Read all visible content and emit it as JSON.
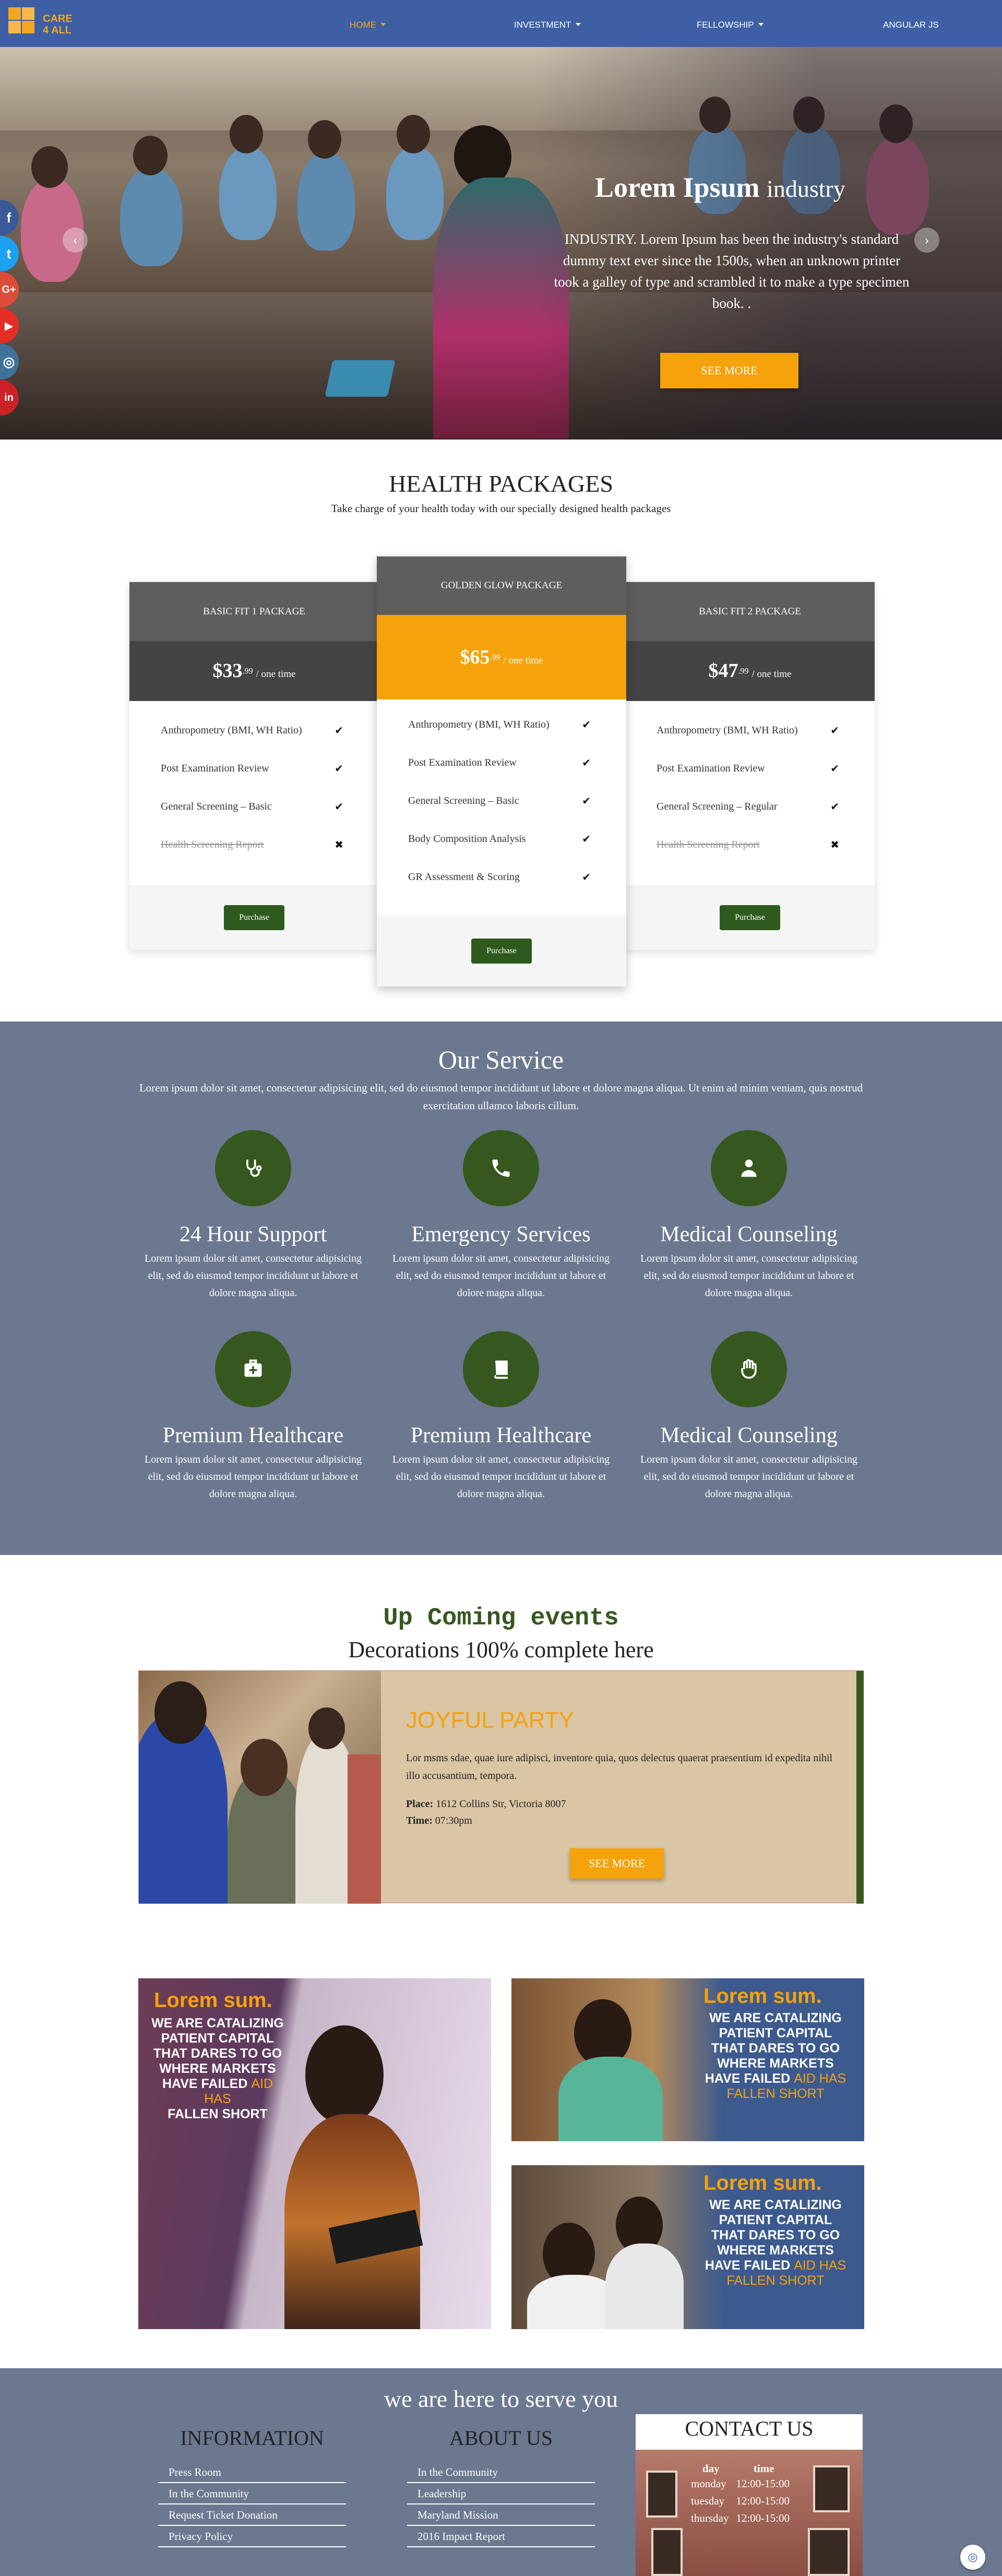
{
  "brand": {
    "line1": "CARE",
    "line2": "4 ALL"
  },
  "nav": {
    "items": [
      {
        "label": "HOME",
        "dropdown": true
      },
      {
        "label": "INVESTMENT",
        "dropdown": true
      },
      {
        "label": "FELLOWSHIP",
        "dropdown": true
      },
      {
        "label": "ANGULAR JS",
        "dropdown": false
      }
    ]
  },
  "hero": {
    "title": "Lorem Ipsum",
    "title_suffix": "industry",
    "text": "INDUSTRY. Lorem Ipsum has been the industry's standard dummy text ever since the 1500s, when an unknown printer took a galley of type and scrambled it to make a type specimen book. .",
    "button": "SEE MORE"
  },
  "social": [
    {
      "icon": "facebook-icon",
      "glyph": "f",
      "color": "#3b5998"
    },
    {
      "icon": "twitter-icon",
      "glyph": "t",
      "color": "#1da1f2"
    },
    {
      "icon": "google-plus-icon",
      "glyph": "G+",
      "color": "#dd4b39"
    },
    {
      "icon": "youtube-icon",
      "glyph": "▶",
      "color": "#e52d27"
    },
    {
      "icon": "instagram-icon",
      "glyph": "◎",
      "color": "#3f729b"
    },
    {
      "icon": "linkedin-icon",
      "glyph": "in",
      "color": "#cc2127"
    }
  ],
  "packages": {
    "title": "HEALTH PACKAGES",
    "subtitle": "Take charge of your health today with our specially designed health packages",
    "items": [
      {
        "name": "BASIC FIT 1 PACKAGE",
        "price": "$33",
        "cents": ".99",
        "period": "/ one time",
        "features": [
          {
            "text": "Anthropometry (BMI, WH Ratio)",
            "included": true
          },
          {
            "text": "Post Examination Review",
            "included": true
          },
          {
            "text": "General Screening – Basic",
            "included": true
          },
          {
            "text": "Health Screening Report",
            "included": false
          }
        ],
        "button": "Purchase"
      },
      {
        "name": "GOLDEN GLOW PACKAGE",
        "price": "$65",
        "cents": ".99",
        "period": "/ one time",
        "features": [
          {
            "text": "Anthropometry (BMI, WH Ratio)",
            "included": true
          },
          {
            "text": "Post Examination Review",
            "included": true
          },
          {
            "text": "General Screening – Basic",
            "included": true
          },
          {
            "text": "Body Composition Analysis",
            "included": true
          },
          {
            "text": "GR Assessment & Scoring",
            "included": true
          }
        ],
        "button": "Purchase"
      },
      {
        "name": "BASIC FIT 2 PACKAGE",
        "price": "$47",
        "cents": ".99",
        "period": "/ one time",
        "features": [
          {
            "text": "Anthropometry (BMI, WH Ratio)",
            "included": true
          },
          {
            "text": "Post Examination Review",
            "included": true
          },
          {
            "text": "General Screening – Regular",
            "included": true
          },
          {
            "text": "Health Screening Report",
            "included": false
          }
        ],
        "button": "Purchase"
      }
    ]
  },
  "service": {
    "title": "Our Service",
    "intro": "Lorem ipsum dolor sit amet, consectetur adipisicing elit, sed do eiusmod tempor incididunt ut labore et dolore magna aliqua. Ut enim ad minim veniam, quis nostrud exercitation ullamco laboris cillum.",
    "items": [
      {
        "icon": "stethoscope-icon",
        "title": "24 Hour Support",
        "text": "Lorem ipsum dolor sit amet, consectetur adipisicing elit, sed do eiusmod tempor incididunt ut labore et dolore magna aliqua."
      },
      {
        "icon": "phone-icon",
        "title": "Emergency Services",
        "text": "Lorem ipsum dolor sit amet, consectetur adipisicing elit, sed do eiusmod tempor incididunt ut labore et dolore magna aliqua."
      },
      {
        "icon": "doctor-icon",
        "title": "Medical Counseling",
        "text": "Lorem ipsum dolor sit amet, consectetur adipisicing elit, sed do eiusmod tempor incididunt ut labore et dolore magna aliqua."
      },
      {
        "icon": "medkit-icon",
        "title": "Premium Healthcare",
        "text": "Lorem ipsum dolor sit amet, consectetur adipisicing elit, sed do eiusmod tempor incididunt ut labore et dolore magna aliqua."
      },
      {
        "icon": "book-icon",
        "title": "Premium Healthcare",
        "text": "Lorem ipsum dolor sit amet, consectetur adipisicing elit, sed do eiusmod tempor incididunt ut labore et dolore magna aliqua."
      },
      {
        "icon": "hand-icon",
        "title": "Medical Counseling",
        "text": "Lorem ipsum dolor sit amet, consectetur adipisicing elit, sed do eiusmod tempor incididunt ut labore et dolore magna aliqua."
      }
    ]
  },
  "events": {
    "title": "Up Coming events",
    "subtitle": "Decorations 100% complete here",
    "card": {
      "heading": "JOYFUL PARTY",
      "text": "Lor msms sdae, quae iure adipisci, inventore quia, quos delectus quaerat praesentium id expedita nihil illo accusantium, tempora.",
      "place_label": "Place:",
      "place": "1612 Collins Str, Victoria 8007",
      "time_label": "Time:",
      "time": "07:30pm",
      "button": "SEE MORE"
    }
  },
  "promos": [
    {
      "heading": "Lorem sum.",
      "line1": "WE ARE CATALIZING",
      "line2": "PATIENT CAPITAL",
      "line3": "THAT DARES TO GO",
      "line4": "WHERE MARKETS",
      "line5": "HAVE FAILED",
      "accent": "AID HAS",
      "line6": "FALLEN SHORT"
    },
    {
      "heading": "Lorem sum.",
      "line1": "WE ARE CATALIZING",
      "line2": "PATIENT CAPITAL",
      "line3": "THAT DARES TO GO",
      "line4": "WHERE MARKETS",
      "line5": "HAVE FAILED",
      "accent": "AID HAS",
      "line6": "FALLEN SHORT"
    },
    {
      "heading": "Lorem sum.",
      "line1": "WE ARE CATALIZING",
      "line2": "PATIENT CAPITAL",
      "line3": "THAT DARES TO GO",
      "line4": "WHERE MARKETS",
      "line5": "HAVE FAILED",
      "accent": "AID HAS",
      "line6": "FALLEN SHORT"
    }
  ],
  "footer": {
    "title": "we are here to serve you",
    "information": {
      "title": "INFORMATION",
      "links": [
        "Press Room",
        "In the Community",
        "Request Ticket Donation",
        "Privacy Policy"
      ]
    },
    "about": {
      "title": "ABOUT US",
      "links": [
        "In the Community",
        "Leadership",
        "Maryland Mission",
        "2016 Impact Report"
      ]
    },
    "contact": {
      "title": "CONTACT US",
      "col_day": "day",
      "col_time": "time",
      "rows": [
        {
          "day": "monday",
          "time": "12:00-15:00"
        },
        {
          "day": "tuesday",
          "time": "12:00-15:00"
        },
        {
          "day": "thursday",
          "time": "12:00-15:00"
        }
      ]
    }
  },
  "colors": {
    "nav": "#3e5fa3",
    "accent": "#f5a20d",
    "green": "#36581f",
    "slate": "#6c7890"
  }
}
